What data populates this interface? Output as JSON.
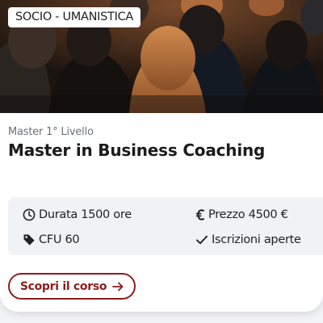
{
  "hero": {
    "image": "audience-crowd-photo",
    "category_tag": "SOCIO - UMANISTICA"
  },
  "course": {
    "level": "Master 1° Livello",
    "title": "Master in Business Coaching"
  },
  "info": {
    "duration": {
      "icon": "clock-icon",
      "text": "Durata 1500 ore"
    },
    "price": {
      "icon": "euro-icon",
      "text": "Prezzo 4500 €"
    },
    "cfu": {
      "icon": "tag-icon",
      "text": "CFU 60"
    },
    "enrollment": {
      "icon": "check-icon",
      "text": "Iscrizioni aperte"
    }
  },
  "cta": {
    "label": "Scopri il corso",
    "icon": "arrow-right-icon"
  },
  "colors": {
    "accent": "#8c1d1d",
    "text": "#1b1b1b",
    "muted": "#6b6f76",
    "info_bg": "#f0f2f5"
  }
}
